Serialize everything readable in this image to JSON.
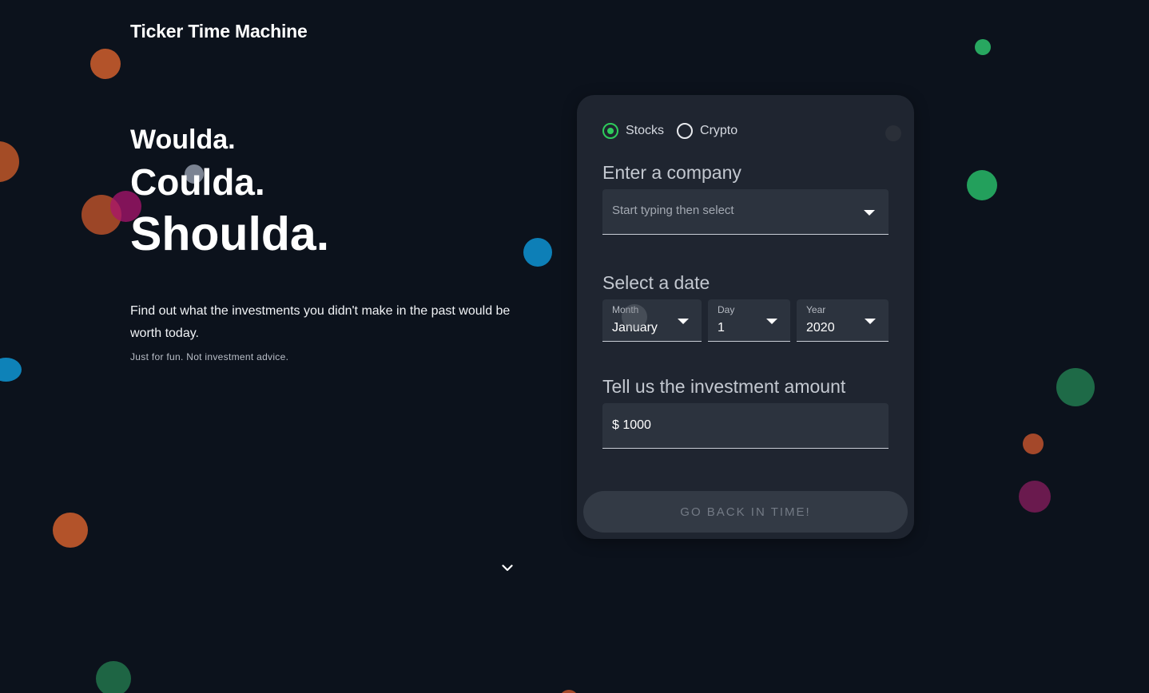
{
  "app": {
    "title": "Ticker Time Machine"
  },
  "hero": {
    "line1": "Woulda.",
    "line2": "Coulda.",
    "line3": "Shoulda."
  },
  "tagline": "Find out what the investments you didn't make in the past would be worth today.",
  "disclaimer": "Just for fun. Not investment advice.",
  "form": {
    "asset_type": {
      "options": [
        {
          "label": "Stocks",
          "selected": true
        },
        {
          "label": "Crypto",
          "selected": false
        }
      ]
    },
    "company": {
      "label": "Enter a company",
      "placeholder": "Start typing then select"
    },
    "date": {
      "label": "Select a date",
      "month": {
        "label": "Month",
        "value": "January"
      },
      "day": {
        "label": "Day",
        "value": "1"
      },
      "year": {
        "label": "Year",
        "value": "2020"
      }
    },
    "amount": {
      "label": "Tell us the investment amount",
      "value": "$ 1000"
    },
    "submit_label": "GO BACK IN TIME!"
  },
  "colors": {
    "background": "#0c121c",
    "card": "#1f2530",
    "accent_green": "#2ecc5b",
    "field": "#2c333e"
  },
  "icons": {
    "scroll": "chevron-down-icon",
    "select": "caret-down-icon"
  }
}
